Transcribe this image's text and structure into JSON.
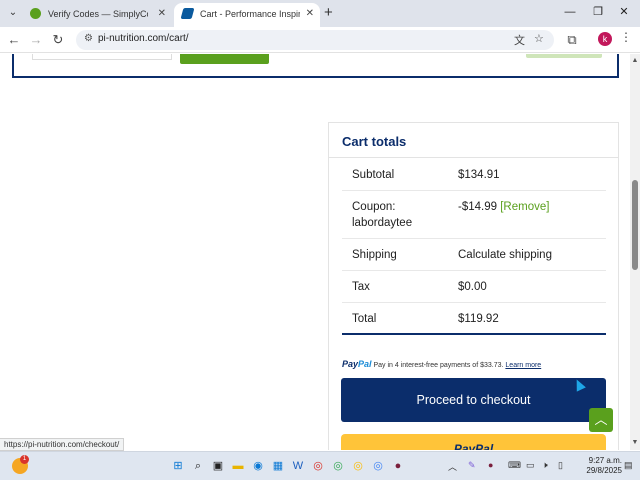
{
  "browser": {
    "tabs": [
      {
        "label": "Verify Codes — SimplyCodes",
        "active": false
      },
      {
        "label": "Cart - Performance Inspired Nu",
        "active": true
      }
    ],
    "url": "pi-nutrition.com/cart/",
    "profile_initial": "k",
    "status_url": "https://pi-nutrition.com/checkout/"
  },
  "cart_totals": {
    "title": "Cart totals",
    "rows": [
      {
        "label": "Subtotal",
        "value": "$134.91"
      },
      {
        "label": "Coupon:",
        "label2": "labordaytee",
        "value": "-$14.99",
        "action": "[Remove]"
      },
      {
        "label": "Shipping",
        "value": "Calculate shipping"
      },
      {
        "label": "Tax",
        "value": "$0.00"
      },
      {
        "label": "Total",
        "value": "$119.92"
      }
    ],
    "paypal_logo": {
      "pay": "Pay",
      "pal": "Pal"
    },
    "paypal_message": "Pay in 4 interest-free payments of $33.73.",
    "paypal_learn_more": "Learn more",
    "checkout_label": "Proceed to checkout",
    "paypal_button_label": "PayPal"
  },
  "taskbar": {
    "badge_count": "1",
    "time": "9:27 a.m.",
    "date": "29/8/2025"
  },
  "colors": {
    "brand_navy": "#0b2d6b",
    "brand_green": "#5aa01d",
    "paypal_yellow": "#ffc439"
  },
  "icons": [
    "tab-list-icon",
    "close-icon",
    "plus-icon",
    "back-arrow-icon",
    "forward-arrow-icon",
    "reload-icon",
    "site-info-icon",
    "translate-icon",
    "star-icon",
    "extensions-icon",
    "kebab-menu-icon",
    "chevron-up-icon",
    "windows-start-icon",
    "search-icon"
  ]
}
